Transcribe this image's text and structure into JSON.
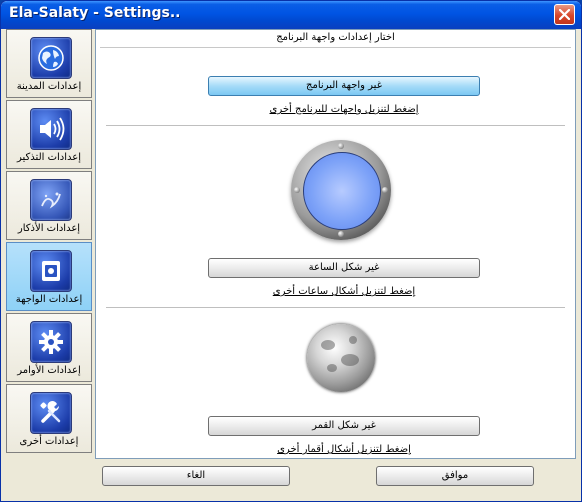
{
  "window": {
    "title": "Ela-Salaty - Settings.."
  },
  "sidebar": {
    "items": [
      {
        "label": "إعدادات المدينة",
        "icon": "globe-icon"
      },
      {
        "label": "إعدادات التذكير",
        "icon": "speaker-icon"
      },
      {
        "label": "إعدادات الأذكار",
        "icon": "quran-icon"
      },
      {
        "label": "إعدادات الواجهة",
        "icon": "interface-icon",
        "active": true
      },
      {
        "label": "إعدادات الأوامر",
        "icon": "gear-icon"
      },
      {
        "label": "إعدادات أخرى",
        "icon": "tools-icon"
      }
    ]
  },
  "main": {
    "header": "اختار إعدادات واجهة البرنامج",
    "interface": {
      "button": "غير واجهة البرنامج",
      "link": "إضغط لتنزيل واجهات للبرنامج أخرى"
    },
    "clock": {
      "button": "غير شكل الساعة",
      "link": "إضغط لتنزيل أشكال ساعات أخرى"
    },
    "moon": {
      "button": "غير شكل القمر",
      "link": "إضغط لتنزيل أشكال أقمار أخرى"
    }
  },
  "footer": {
    "ok": "موافق",
    "cancel": "الغاء"
  },
  "colors": {
    "titlebar": "#0054e3",
    "active_item": "#8ed1f6",
    "primary_button": "#a6dbf8"
  }
}
